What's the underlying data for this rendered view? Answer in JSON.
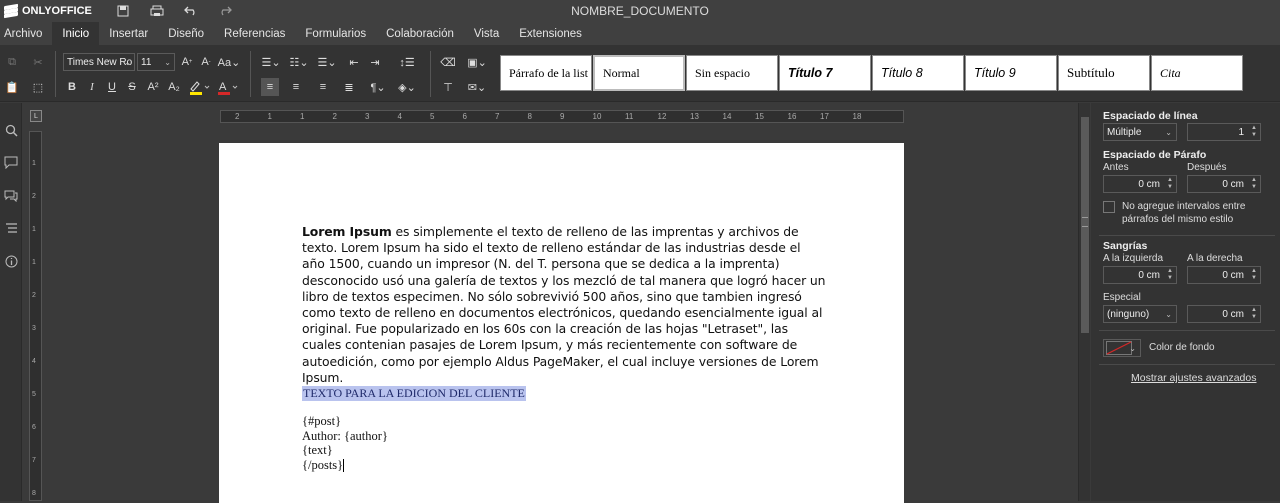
{
  "app": {
    "brand": "ONLYOFFICE",
    "document_title": "NOMBRE_DOCUMENTO",
    "title_icons": [
      "save-icon",
      "print-icon",
      "undo-icon",
      "redo-icon"
    ]
  },
  "menu": {
    "items": [
      "Archivo",
      "Inicio",
      "Insertar",
      "Diseño",
      "Referencias",
      "Formularios",
      "Colaboración",
      "Vista",
      "Extensiones"
    ],
    "active": "Inicio"
  },
  "toolbar": {
    "font_name": "Times New Ro",
    "font_size": "11",
    "styles": [
      "Párrafo de la list",
      "Normal",
      "Sin espacio",
      "Título 7",
      "Título 8",
      "Título 9",
      "Subtítulo",
      "Cita"
    ],
    "selected_style": "Normal",
    "highlight_color": "#ffe600",
    "font_color": "#d62828"
  },
  "ruler": {
    "h_labels": [
      "2",
      "1",
      "1",
      "2",
      "3",
      "4",
      "5",
      "6",
      "7",
      "8",
      "9",
      "10",
      "11",
      "12",
      "13",
      "14",
      "15",
      "16",
      "17",
      "18"
    ],
    "v_labels": [
      "1",
      "2",
      "1",
      "1",
      "2",
      "3",
      "4",
      "5",
      "6",
      "7",
      "8"
    ]
  },
  "document": {
    "paragraph_bold": "Lorem Ipsum",
    "paragraph_rest": " es simplemente el texto de relleno de las imprentas y archivos de texto. Lorem Ipsum ha sido el texto de relleno estándar de las industrias desde el año 1500, cuando un impresor (N. del T. persona que se dedica a la imprenta) desconocido usó una galería de textos y los mezcló de tal manera que logró hacer un libro de textos especimen. No sólo sobrevivió 500 años, sino que tambien ingresó como texto de relleno en documentos electrónicos, quedando esencialmente igual al original. Fue popularizado en los 60s con la creación de las hojas \"Letraset\", las cuales contenian pasajes de Lorem Ipsum, y más recientemente con software de autoedición, como por ejemplo Aldus PageMaker, el cual incluye versiones de Lorem Ipsum.",
    "highlighted": "TEXTO PARA LA EDICION DEL CLIENTE",
    "template_lines": [
      "{#post}",
      "Author: {author}",
      "{text}",
      "{/posts}"
    ]
  },
  "panel": {
    "line_spacing_title": "Espaciado de línea",
    "line_spacing_mode": "Múltiple",
    "line_spacing_value": "1",
    "para_spacing_title": "Espaciado de Párafo",
    "before_label": "Antes",
    "after_label": "Después",
    "before_value": "0 cm",
    "after_value": "0 cm",
    "no_interval_label": "No agregue intervalos entre párrafos del mismo estilo",
    "indent_title": "Sangrías",
    "left_label": "A la izquierda",
    "right_label": "A la derecha",
    "left_value": "0 cm",
    "right_value": "0 cm",
    "special_label": "Especial",
    "special_mode": "(ninguno)",
    "special_value": "0 cm",
    "bg_color_label": "Color de fondo",
    "advanced_link": "Mostrar ajustes avanzados"
  }
}
